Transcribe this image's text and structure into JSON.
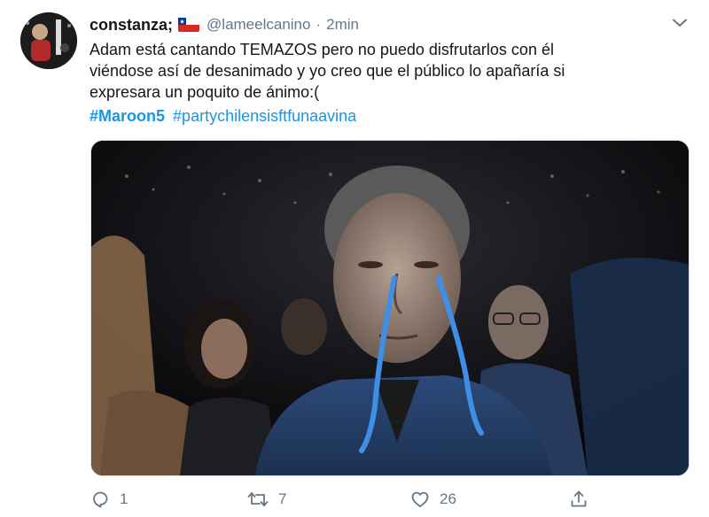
{
  "tweet": {
    "author": {
      "display_name": "constanza;",
      "flag_icon": "chile-flag-icon",
      "handle": "@lameelcanino",
      "separator": "·",
      "time": "2min"
    },
    "text_lines": [
      "Adam está cantando TEMAZOS pero no puedo disfrutarlos con él",
      "viéndose así de desanimado y yo creo que el público lo apañaría si",
      "expresara un poquito de ánimo:("
    ],
    "hashtags": [
      "#Maroon5",
      "#partychilensisftfunaavina"
    ],
    "actions": {
      "reply_count": "1",
      "retweet_count": "7",
      "like_count": "26"
    },
    "colors": {
      "link": "#1b95e0",
      "secondary_text": "#657786",
      "primary_text": "#14171a",
      "tear_marks": "#3f8fe6"
    }
  }
}
